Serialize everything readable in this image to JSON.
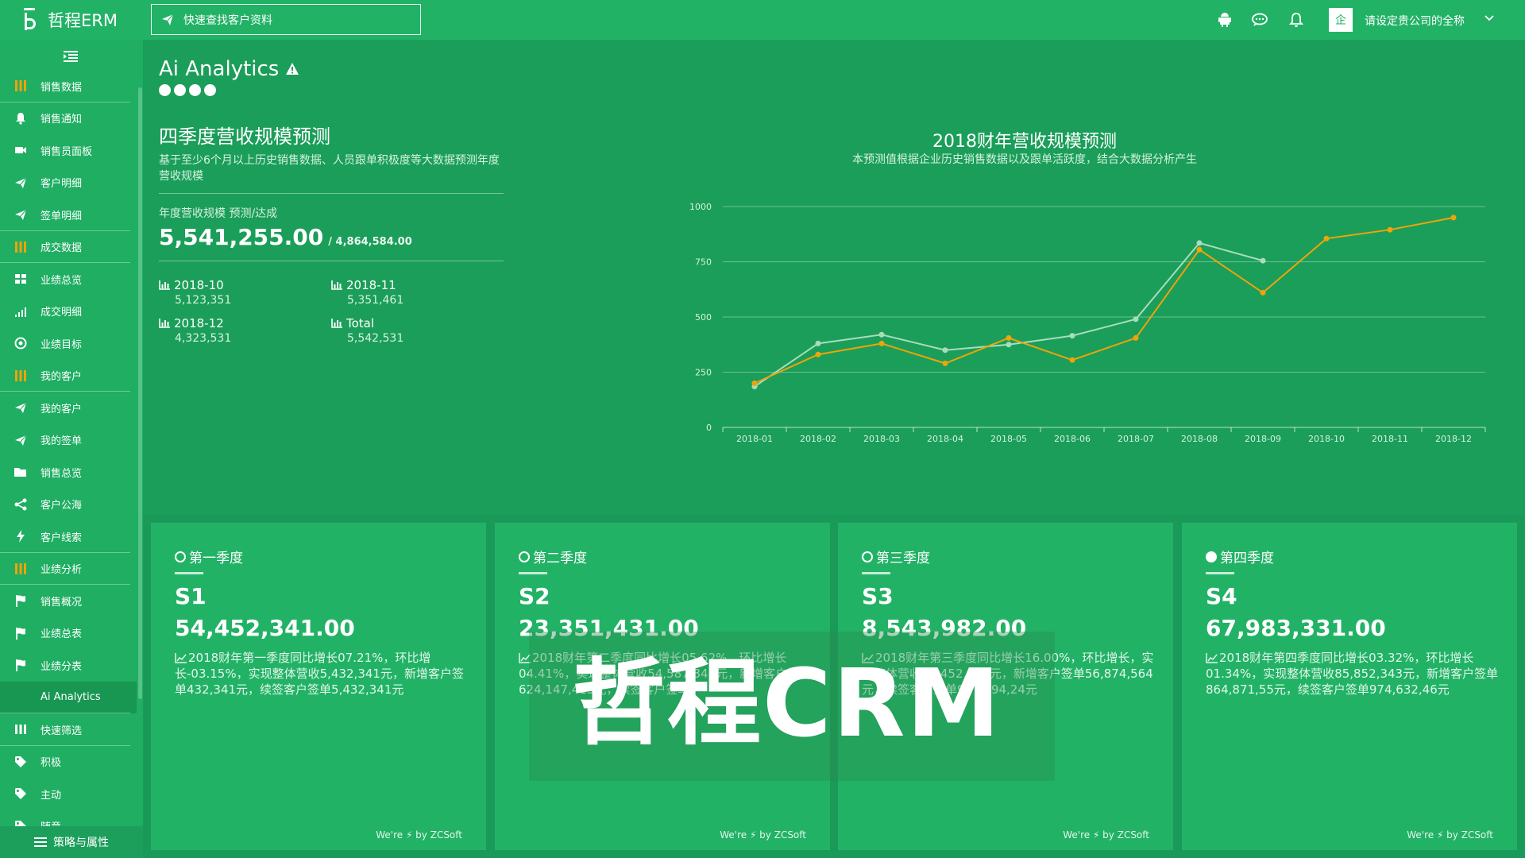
{
  "header": {
    "app_name": "哲程ERM",
    "search_placeholder": "快速查找客户资料",
    "company_avatar": "企",
    "company_name": "请设定贵公司的全称",
    "icons": [
      "android-icon",
      "chat-icon",
      "bell-icon"
    ]
  },
  "sidebar": {
    "items": [
      {
        "label": "销售数据",
        "icon": "bars-icon"
      },
      {
        "label": "销售通知",
        "icon": "bell-icon"
      },
      {
        "label": "销售员面板",
        "icon": "video-icon"
      },
      {
        "label": "客户明细",
        "icon": "send-icon"
      },
      {
        "label": "签单明细",
        "icon": "send-icon"
      },
      {
        "label": "成交数据",
        "icon": "bars-icon"
      },
      {
        "label": "业绩总览",
        "icon": "grid-icon"
      },
      {
        "label": "成交明细",
        "icon": "signal-icon"
      },
      {
        "label": "业绩目标",
        "icon": "target-icon"
      },
      {
        "label": "我的客户",
        "icon": "bars-icon"
      },
      {
        "label": "我的客户",
        "icon": "send-icon"
      },
      {
        "label": "我的签单",
        "icon": "send-icon"
      },
      {
        "label": "销售总览",
        "icon": "folder-icon"
      },
      {
        "label": "客户公海",
        "icon": "share-icon"
      },
      {
        "label": "客户线索",
        "icon": "bolt-icon"
      },
      {
        "label": "业绩分析",
        "icon": "bars-icon"
      },
      {
        "label": "销售概况",
        "icon": "flag-icon"
      },
      {
        "label": "业绩总表",
        "icon": "flag-icon"
      },
      {
        "label": "业绩分表",
        "icon": "flag-icon"
      },
      {
        "label": "Ai Analytics",
        "icon": "none"
      },
      {
        "label": "快速筛选",
        "icon": "columns-icon"
      },
      {
        "label": "积极",
        "icon": "tag-icon"
      },
      {
        "label": "主动",
        "icon": "tag-icon"
      },
      {
        "label": "随意",
        "icon": "tag-icon"
      }
    ],
    "footer_label": "策略与属性"
  },
  "analytics": {
    "title": "Ai Analytics",
    "heading": "四季度营收规模预测",
    "description": "基于至少6个月以上历史销售数据、人员跟单积极度等大数据预测年度营收规模",
    "kpi_label": "年度营收规模 预测/达成",
    "kpi_value": "5,541,255.00",
    "kpi_target": "/ 4,864,584.00",
    "stats": [
      {
        "label": "2018-10",
        "value": "5,123,351"
      },
      {
        "label": "2018-11",
        "value": "5,351,461"
      },
      {
        "label": "2018-12",
        "value": "4,323,531"
      },
      {
        "label": "Total",
        "value": "5,542,531"
      }
    ]
  },
  "chart_data": {
    "type": "line",
    "title": "2018财年营收规模预测",
    "subtitle": "本预测值根据企业历史销售数据以及跟单活跃度，结合大数据分析产生",
    "categories": [
      "2018-01",
      "2018-02",
      "2018-03",
      "2018-04",
      "2018-05",
      "2018-06",
      "2018-07",
      "2018-08",
      "2018-09",
      "2018-10",
      "2018-11",
      "2018-12"
    ],
    "series": [
      {
        "color": "#a9dcbd",
        "values": [
          185,
          380,
          420,
          350,
          375,
          415,
          490,
          835,
          755,
          null,
          null,
          null
        ]
      },
      {
        "color": "#f0a30a",
        "values": [
          200,
          330,
          380,
          290,
          405,
          305,
          405,
          805,
          610,
          855,
          895,
          950
        ]
      }
    ],
    "ylim": [
      0,
      1000
    ],
    "yticks": [
      0,
      250,
      500,
      750,
      1000
    ],
    "grid": true
  },
  "seasons": [
    {
      "name": "第一季度",
      "code": "S1",
      "value": "54,452,341.00",
      "desc": "2018财年第一季度同比增长07.21%，环比增长-03.15%，实现整体营收5,432,341元，新增客户签单432,341元，续签客户签单5,432,341元",
      "footer": "We're ⚡ by ZCSoft",
      "current": false
    },
    {
      "name": "第二季度",
      "code": "S2",
      "value": "23,351,431.00",
      "desc": "2018财年第二季度同比增长05.62%，环比增长04.41%，实现整体营收54,587,345元，新增客户签单624,147,415元，续签客户签单",
      "footer": "We're ⚡ by ZCSoft",
      "current": false
    },
    {
      "name": "第三季度",
      "code": "S3",
      "value": "8,543,982.00",
      "desc": "2018财年第三季度同比增长16.00%，环比增长，实现整体营收57,452,341元，新增客户签单56,874,564元，续签客户签单967,594,24元",
      "footer": "We're ⚡ by ZCSoft",
      "current": false
    },
    {
      "name": "第四季度",
      "code": "S4",
      "value": "67,983,331.00",
      "desc": "2018财年第四季度同比增长03.32%，环比增长01.34%，实现整体营收85,852,343元，新增客户签单864,871,55元，续签客户签单974,632,46元",
      "footer": "We're ⚡ by ZCSoft",
      "current": true
    }
  ],
  "watermark": "哲程CRM"
}
